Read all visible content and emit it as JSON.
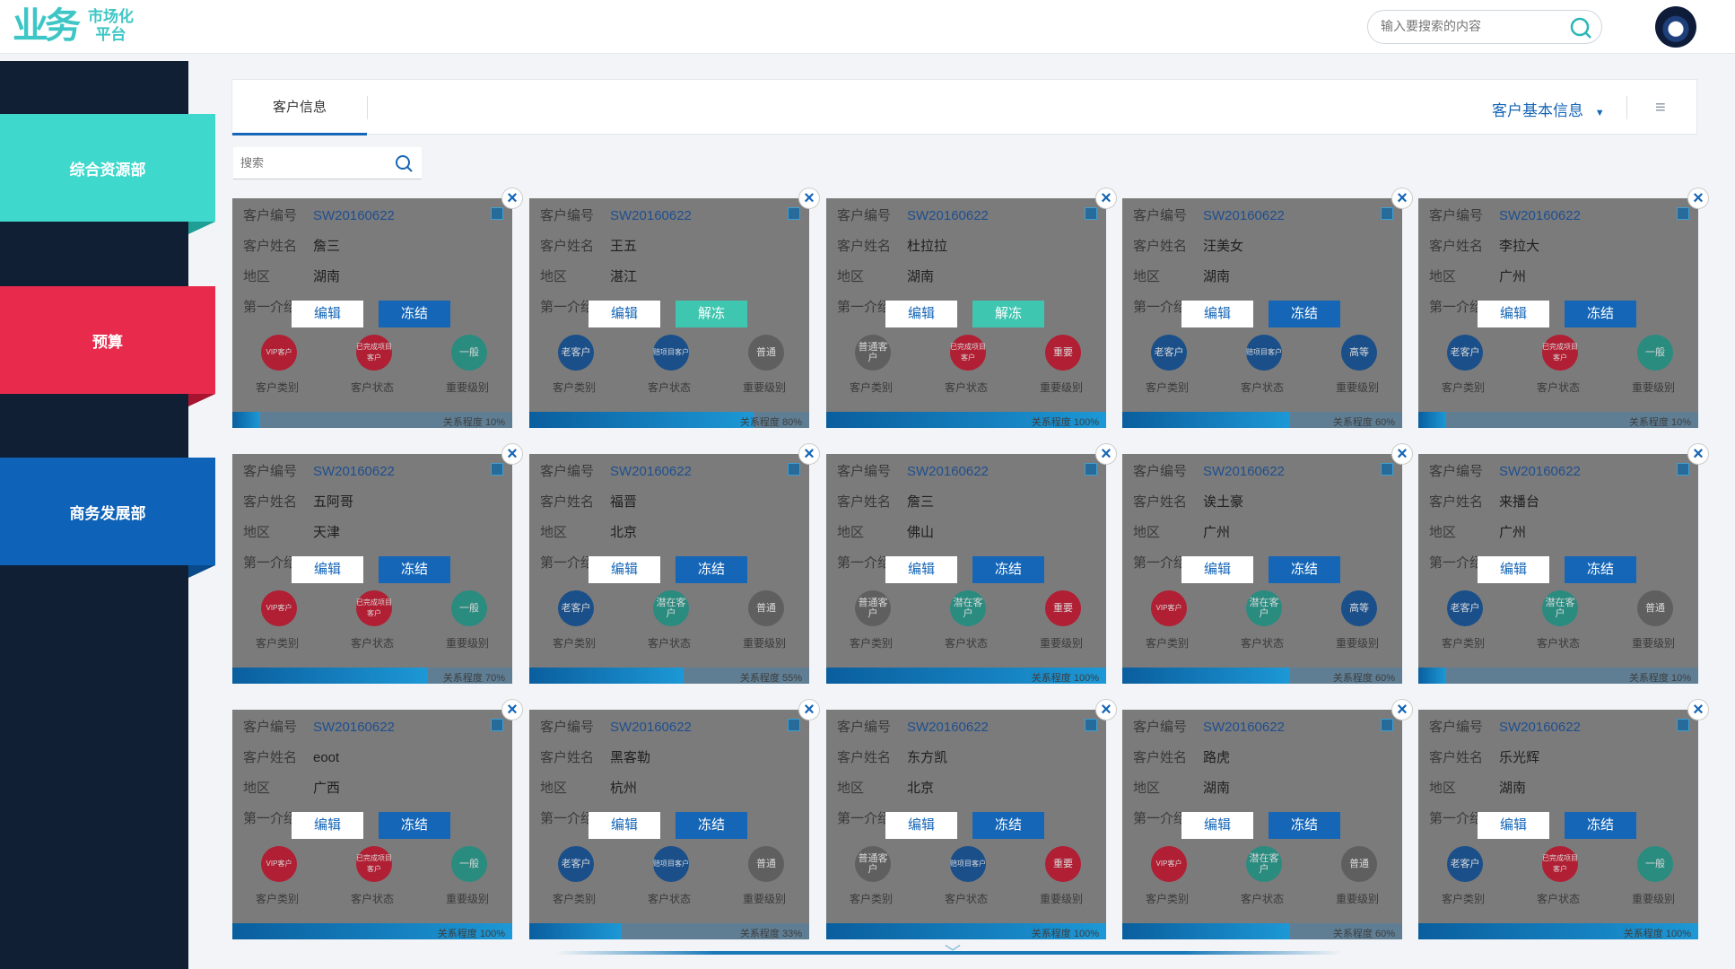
{
  "app": {
    "logo_mark": "业务",
    "logo_line1": "市场化",
    "logo_line2": "平台"
  },
  "header": {
    "search_placeholder": "输入要搜索的内容"
  },
  "sidebar": {
    "departments": [
      {
        "label": "综合资源部",
        "color": "#3ed8cc",
        "fold": "#1e9e95"
      },
      {
        "label": "预算",
        "color": "#e82a4c",
        "fold": "#a8142f"
      },
      {
        "label": "商务发展部",
        "color": "#0e63b8",
        "fold": "#094a8a"
      }
    ]
  },
  "main": {
    "tab": "客户信息",
    "dropdown": "客户基本信息",
    "filter_placeholder": "搜索"
  },
  "labels": {
    "code": "客户编号",
    "name": "客户姓名",
    "region": "地区",
    "intro": "第一介绍",
    "category": "客户类别",
    "status": "客户状态",
    "importance": "重要级别",
    "relation": "关系程度",
    "edit": "编辑"
  },
  "cards": [
    {
      "code": "SW20160622",
      "name": "詹三",
      "region": "湖南",
      "action": "冻结",
      "cat": "VIP客户",
      "catColor": "#b01f33",
      "status": "已完成项目客户",
      "statusColor": "#b01f33",
      "imp": "一般",
      "impColor": "#2a8b7f",
      "progress": 10
    },
    {
      "code": "SW20160622",
      "name": "王五",
      "region": "湛江",
      "action": "解冻",
      "cat": "老客户",
      "catColor": "#1a4f8a",
      "status": "赔项目客户",
      "statusColor": "#1a4f8a",
      "imp": "普通",
      "impColor": "#5f5f5f",
      "progress": 80
    },
    {
      "code": "SW20160622",
      "name": "杜拉拉",
      "region": "湖南",
      "action": "解冻",
      "cat": "普通客户",
      "catColor": "#5f5f5f",
      "status": "已完成项目客户",
      "statusColor": "#b01f33",
      "imp": "重要",
      "impColor": "#b01f33",
      "progress": 100
    },
    {
      "code": "SW20160622",
      "name": "汪美女",
      "region": "湖南",
      "action": "冻结",
      "cat": "老客户",
      "catColor": "#1a4f8a",
      "status": "赔项目客户",
      "statusColor": "#1a4f8a",
      "imp": "高等",
      "impColor": "#1a4f8a",
      "progress": 60
    },
    {
      "code": "SW20160622",
      "name": "李拉大",
      "region": "广州",
      "action": "冻结",
      "cat": "老客户",
      "catColor": "#1a4f8a",
      "status": "已完成项目客户",
      "statusColor": "#b01f33",
      "imp": "一般",
      "impColor": "#2a8b7f",
      "progress": 10
    },
    {
      "code": "SW20160622",
      "name": "五阿哥",
      "region": "天津",
      "action": "冻结",
      "cat": "VIP客户",
      "catColor": "#b01f33",
      "status": "已完成项目客户",
      "statusColor": "#b01f33",
      "imp": "一般",
      "impColor": "#2a8b7f",
      "progress": 70
    },
    {
      "code": "SW20160622",
      "name": "福晋",
      "region": "北京",
      "action": "冻结",
      "cat": "老客户",
      "catColor": "#1a4f8a",
      "status": "潜在客户",
      "statusColor": "#2a8b7f",
      "imp": "普通",
      "impColor": "#5f5f5f",
      "progress": 55
    },
    {
      "code": "SW20160622",
      "name": "詹三",
      "region": "佛山",
      "action": "冻结",
      "cat": "普通客户",
      "catColor": "#5f5f5f",
      "status": "潜在客户",
      "statusColor": "#2a8b7f",
      "imp": "重要",
      "impColor": "#b01f33",
      "progress": 100
    },
    {
      "code": "SW20160622",
      "name": "诶土豪",
      "region": "广州",
      "action": "冻结",
      "cat": "VIP客户",
      "catColor": "#b01f33",
      "status": "潜在客户",
      "statusColor": "#2a8b7f",
      "imp": "高等",
      "impColor": "#1a4f8a",
      "progress": 60
    },
    {
      "code": "SW20160622",
      "name": "来播台",
      "region": "广州",
      "action": "冻结",
      "cat": "老客户",
      "catColor": "#1a4f8a",
      "status": "潜在客户",
      "statusColor": "#2a8b7f",
      "imp": "普通",
      "impColor": "#5f5f5f",
      "progress": 10
    },
    {
      "code": "SW20160622",
      "name": "eoot",
      "region": "广西",
      "action": "冻结",
      "cat": "VIP客户",
      "catColor": "#b01f33",
      "status": "已完成项目客户",
      "statusColor": "#b01f33",
      "imp": "一般",
      "impColor": "#2a8b7f",
      "progress": 100
    },
    {
      "code": "SW20160622",
      "name": "黑客勒",
      "region": "杭州",
      "action": "冻结",
      "cat": "老客户",
      "catColor": "#1a4f8a",
      "status": "赔项目客户",
      "statusColor": "#1a4f8a",
      "imp": "普通",
      "impColor": "#5f5f5f",
      "progress": 33
    },
    {
      "code": "SW20160622",
      "name": "东方凯",
      "region": "北京",
      "action": "冻结",
      "cat": "普通客户",
      "catColor": "#5f5f5f",
      "status": "赔项目客户",
      "statusColor": "#1a4f8a",
      "imp": "重要",
      "impColor": "#b01f33",
      "progress": 100
    },
    {
      "code": "SW20160622",
      "name": "路虎",
      "region": "湖南",
      "action": "冻结",
      "cat": "VIP客户",
      "catColor": "#b01f33",
      "status": "潜在客户",
      "statusColor": "#2a8b7f",
      "imp": "普通",
      "impColor": "#5f5f5f",
      "progress": 60
    },
    {
      "code": "SW20160622",
      "name": "乐光辉",
      "region": "湖南",
      "action": "冻结",
      "cat": "老客户",
      "catColor": "#1a4f8a",
      "status": "已完成项目客户",
      "statusColor": "#b01f33",
      "imp": "一般",
      "impColor": "#2a8b7f",
      "progress": 100
    }
  ]
}
